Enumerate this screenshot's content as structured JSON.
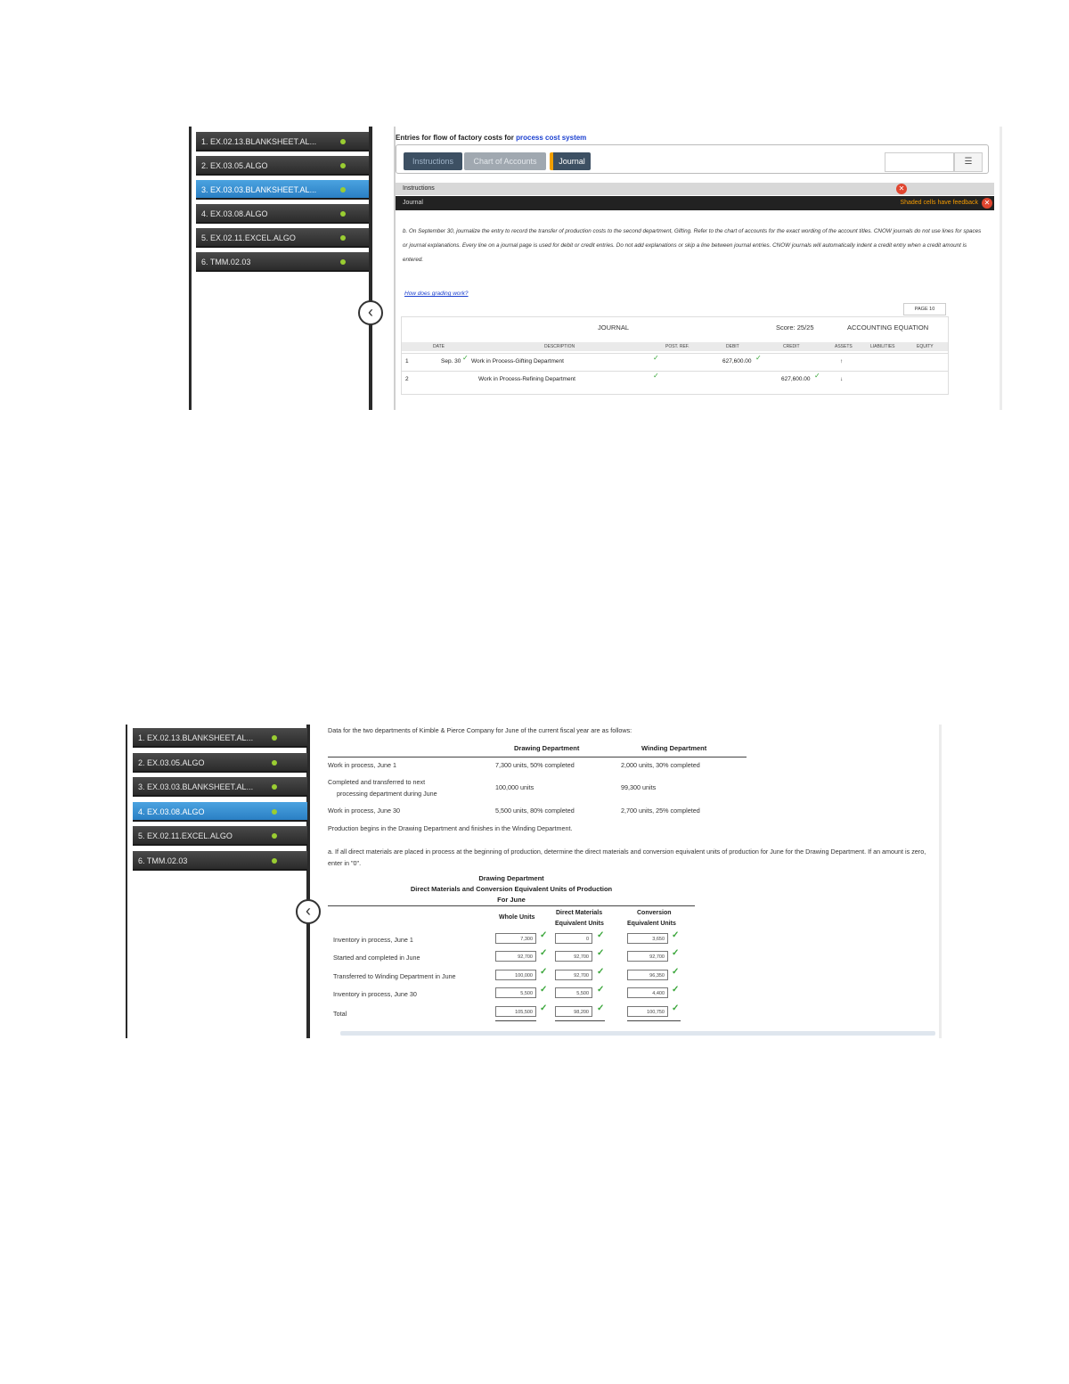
{
  "shot1": {
    "sidebar": [
      {
        "label": "1. EX.02.13.BLANKSHEET.AL...",
        "active": false
      },
      {
        "label": "2. EX.03.05.ALGO",
        "active": false
      },
      {
        "label": "3. EX.03.03.BLANKSHEET.AL...",
        "active": true
      },
      {
        "label": "4. EX.03.08.ALGO",
        "active": false
      },
      {
        "label": "5. EX.02.11.EXCEL.ALGO",
        "active": false
      },
      {
        "label": "6. TMM.02.03",
        "active": false
      }
    ],
    "title_prefix": "Entries for flow of factory costs for",
    "title_link": "process cost system",
    "tabs": {
      "instructions": "Instructions",
      "chart": "Chart of Accounts",
      "journal": "Journal"
    },
    "instructions_bar": "Instructions",
    "journal_bar": "Journal",
    "feedback_text": "Shaded cells have feedback",
    "instruction_text": "b. On September 30, journalize the entry to record the transfer of production costs to the second department, Gifting. Refer to the chart of accounts for the exact wording of the account titles. CNOW journals do not use lines for spaces or journal explanations. Every line on a journal page is used for debit or credit entries. Do not add explanations or skip a line between journal entries. CNOW journals will automatically indent a credit entry when a credit amount is entered.",
    "how_link": "How does grading work?",
    "page_label": "PAGE 10",
    "journal": {
      "title": "JOURNAL",
      "score": "Score: 25/25",
      "equation": "ACCOUNTING EQUATION",
      "columns": [
        "DATE",
        "DESCRIPTION",
        "POST. REF.",
        "DEBIT",
        "CREDIT",
        "ASSETS",
        "LIABILITIES",
        "EQUITY"
      ],
      "rows": [
        {
          "num": "1",
          "date": "Sep. 30",
          "description": "Work in Process-Gifting Department",
          "post_ref": "",
          "debit": "627,600.00",
          "credit": "",
          "assets": "↑"
        },
        {
          "num": "2",
          "date": "",
          "description": "Work in Process-Refining Department",
          "post_ref": "",
          "debit": "",
          "credit": "627,600.00",
          "assets": "↓"
        }
      ]
    }
  },
  "shot2": {
    "sidebar": [
      {
        "label": "1. EX.02.13.BLANKSHEET.AL...",
        "active": false
      },
      {
        "label": "2. EX.03.05.ALGO",
        "active": false
      },
      {
        "label": "3. EX.03.03.BLANKSHEET.AL...",
        "active": false
      },
      {
        "label": "4. EX.03.08.ALGO",
        "active": true
      },
      {
        "label": "5. EX.02.11.EXCEL.ALGO",
        "active": false
      },
      {
        "label": "6. TMM.02.03",
        "active": false
      }
    ],
    "intro": "Data for the two departments of Kimble & Pierce Company for June of the current fiscal year are as follows:",
    "dept_headers": [
      "Drawing Department",
      "Winding Department"
    ],
    "data_rows": [
      {
        "label": "Work in process, June 1",
        "drawing": "7,300 units, 50% completed",
        "winding": "2,000 units, 30% completed"
      },
      {
        "label_1": "Completed and transferred to next",
        "label_2": "processing department during June",
        "drawing": "100,000 units",
        "winding": "99,300 units"
      },
      {
        "label": "Work in process, June 30",
        "drawing": "5,500 units, 80% completed",
        "winding": "2,700 units, 25% completed"
      }
    ],
    "note": "Production begins in the Drawing Department and finishes in the Winding Department.",
    "question": "a. If all direct materials are placed in process at the beginning of production, determine the direct materials and conversion equivalent units of production for June for the Drawing Department. If an amount is zero, enter in \"0\".",
    "report_title": [
      "Drawing Department",
      "Direct Materials and Conversion Equivalent Units of Production",
      "For June"
    ],
    "col_heads": {
      "whole": "Whole Units",
      "dm_1": "Direct Materials",
      "dm_2": "Equivalent Units",
      "conv_1": "Conversion",
      "conv_2": "Equivalent Units"
    },
    "eu_rows": [
      {
        "label": "Inventory in process, June 1",
        "whole": "7,300",
        "dm": "0",
        "conv": "3,650"
      },
      {
        "label": "Started and completed in June",
        "whole": "92,700",
        "dm": "92,700",
        "conv": "92,700"
      },
      {
        "label": "Transferred to Winding Department in June",
        "whole": "100,000",
        "dm": "92,700",
        "conv": "96,350"
      },
      {
        "label": "Inventory in process, June 30",
        "whole": "5,500",
        "dm": "5,500",
        "conv": "4,400"
      },
      {
        "label": "Total",
        "whole": "105,500",
        "dm": "98,200",
        "conv": "100,750"
      }
    ]
  }
}
